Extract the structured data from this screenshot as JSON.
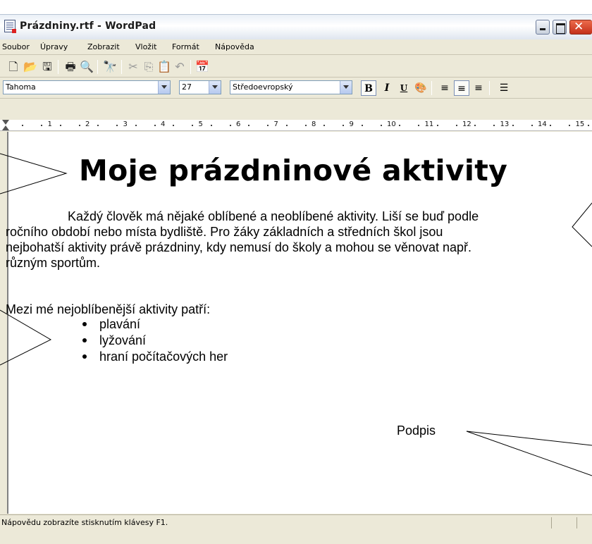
{
  "window": {
    "title": "Prázdniny.rtf - WordPad"
  },
  "menu": [
    "Soubor",
    "Úpravy",
    "Zobrazit",
    "Vložit",
    "Formát",
    "Nápověda"
  ],
  "format": {
    "font": "Tahoma",
    "size": "27",
    "script": "Středoevropský",
    "bold_label": "B",
    "italic_label": "I",
    "underline_label": "U"
  },
  "ruler": {
    "numbers": [
      "1",
      "2",
      "3",
      "4",
      "5",
      "6",
      "7",
      "8",
      "9",
      "10",
      "11",
      "12",
      "13",
      "14",
      "15"
    ]
  },
  "document": {
    "heading": "Moje prázdninové aktivity",
    "paragraph_lines": [
      "Každý člověk má nějaké oblíbené a neoblíbené aktivity. Liší se buď  podle",
      "ročního období nebo místa bydliště. Pro žáky základních a středních škol jsou",
      "nejbohatší aktivity právě prázdniny, kdy nemusí do školy a mohou se věnovat např.",
      "různým sportům."
    ],
    "list_intro": "Mezi mé nejoblíbenější aktivity patří:",
    "list_items": [
      "plavání",
      "lyžování",
      "hraní počítačových her"
    ],
    "signature": "Podpis"
  },
  "status": {
    "text": "Nápovědu zobrazíte stisknutím klávesy F1."
  },
  "icons": [
    "new-icon",
    "open-icon",
    "save-icon",
    "print-icon",
    "print-preview-icon",
    "find-icon",
    "cut-icon",
    "copy-icon",
    "paste-icon",
    "undo-icon",
    "date-time-icon",
    "color-icon",
    "align-left-icon",
    "align-center-icon",
    "align-right-icon",
    "bullets-icon"
  ]
}
